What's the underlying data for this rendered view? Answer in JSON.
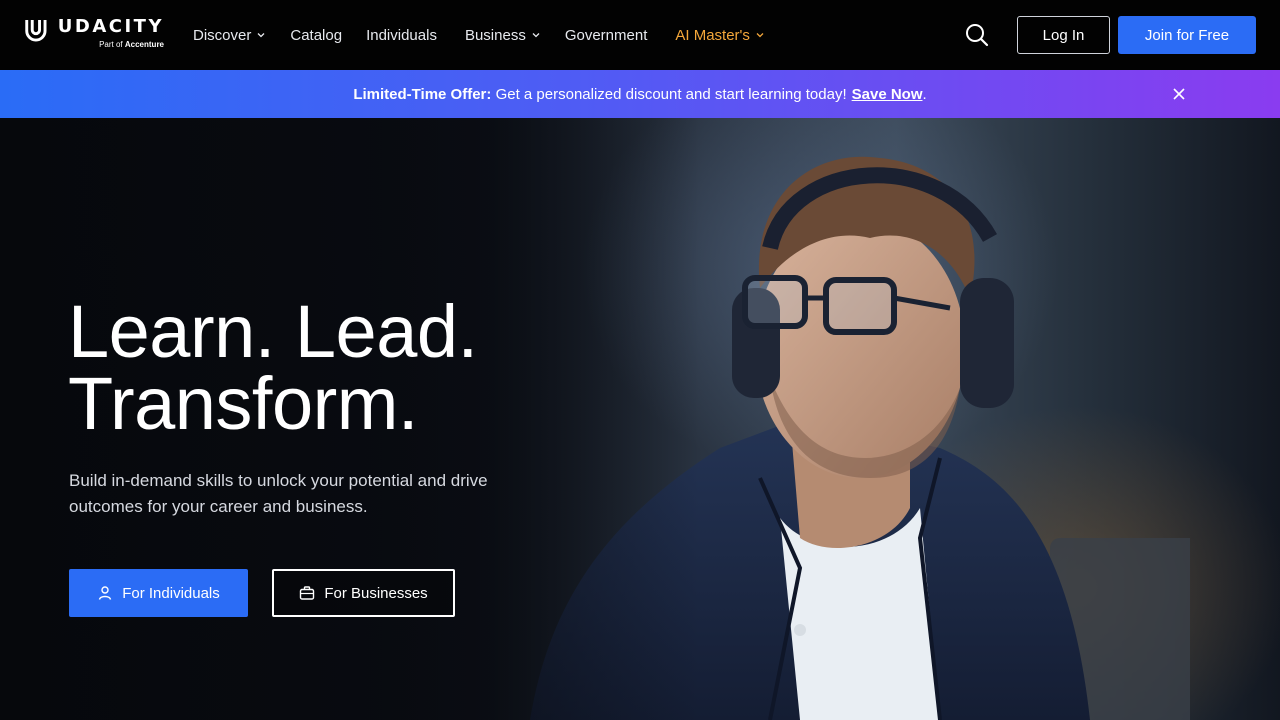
{
  "brand": {
    "name": "UDACITY",
    "sub_prefix": "Part of",
    "sub_company": "Accenture"
  },
  "nav": {
    "items": [
      {
        "label": "Discover",
        "icon": "chevron-down-icon"
      },
      {
        "label": "Catalog"
      },
      {
        "label": "Individuals"
      },
      {
        "label": "Business",
        "icon": "chevron-down-icon"
      },
      {
        "label": "Government"
      },
      {
        "label": "AI Master's",
        "icon": "chevron-down-icon",
        "color": "#f4a73a"
      }
    ],
    "search_icon": "search-icon",
    "login_label": "Log In",
    "join_label": "Join for Free",
    "join_color": "#2b6cf5"
  },
  "banner": {
    "offer_label": "Limited-Time Offer:",
    "offer_text": "Get a personalized discount and start learning today!",
    "cta": "Save Now",
    "trailing": ".",
    "close_icon": "close-icon",
    "gradient": [
      "#2a6cf6",
      "#8a3cf0"
    ]
  },
  "hero": {
    "title_line1": "Learn. Lead.",
    "title_line2": "Transform.",
    "subtitle": "Build in-demand skills to unlock your potential and drive outcomes for your career and business.",
    "btn_individuals": "For Individuals",
    "btn_individuals_icon": "user-icon",
    "btn_businesses": "For Businesses",
    "btn_businesses_icon": "briefcase-icon",
    "image": "man-with-headphones-photo"
  }
}
